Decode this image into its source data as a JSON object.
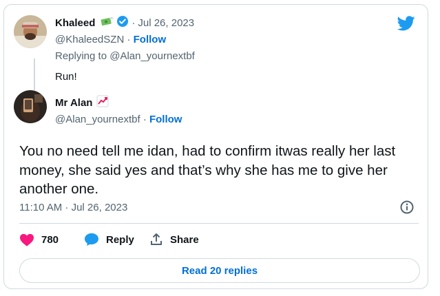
{
  "reply_tweet": {
    "author_name": "Khaleed",
    "name_emoji": "money-with-wings-emoji",
    "verified": "verified-badge",
    "date": "Jul 26, 2023",
    "handle": "@KhaleedSZN",
    "follow_label": "Follow",
    "replying_to_prefix": "Replying to",
    "replying_to_handle": "@Alan_yournextbf",
    "text": "Run!"
  },
  "main_tweet": {
    "author_name": "Mr Alan",
    "name_emoji": "chart-increasing-emoji",
    "handle": "@Alan_yournextbf",
    "follow_label": "Follow",
    "text": "You no need tell me idan, had to confirm itwas really her last money, she said yes and that’s why she has me to give her another one.",
    "timestamp": "11:10 AM · Jul 26, 2023"
  },
  "actions": {
    "like_count": "780",
    "reply_label": "Reply",
    "share_label": "Share"
  },
  "read_replies_label": "Read 20 replies",
  "colors": {
    "brand_blue": "#1d9bf0",
    "link_blue": "#006fd6",
    "heart_pink": "#f91880",
    "text_primary": "#0f1419",
    "text_muted": "#536471",
    "border": "#cfd9de"
  },
  "icons": {
    "logo": "twitter-bird-icon",
    "info": "info-icon",
    "like": "heart-icon",
    "reply": "speech-bubble-icon",
    "share": "share-upload-icon"
  }
}
